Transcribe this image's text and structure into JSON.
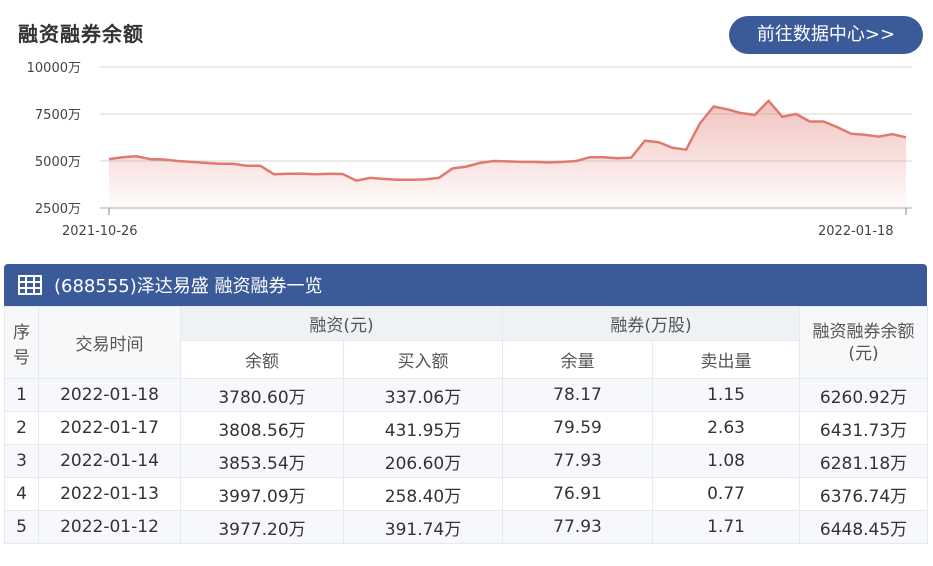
{
  "page": {
    "title": "融资融券余额",
    "goto_label": "前往数据中心>>"
  },
  "chart_data": {
    "type": "area",
    "title": "",
    "ylim": [
      2500,
      10000
    ],
    "yticks": [
      "10000万",
      "7500万",
      "5000万",
      "2500万"
    ],
    "ytick_values": [
      10000,
      7500,
      5000,
      2500
    ],
    "x_start_label": "2021-10-26",
    "x_end_label": "2022-01-18",
    "color": "#e07a70",
    "series": [
      {
        "values": [
          5100,
          5200,
          5250,
          5100,
          5080,
          5000,
          4950,
          4900,
          4850,
          4850,
          4750,
          4750,
          4300,
          4320,
          4330,
          4300,
          4320,
          4310,
          3960,
          4100,
          4050,
          4000,
          4000,
          4020,
          4100,
          4600,
          4700,
          4900,
          5000,
          4980,
          4950,
          4950,
          4920,
          4950,
          5000,
          5200,
          5200,
          5150,
          5180,
          6080,
          6000,
          5700,
          5600,
          7000,
          7900,
          7750,
          7550,
          7450,
          8200,
          7350,
          7500,
          7100,
          7100,
          6800,
          6450,
          6400,
          6300,
          6430,
          6260
        ]
      }
    ]
  },
  "table": {
    "title": "(688555)泽达易盛 融资融券一览",
    "headers": {
      "index": "序号",
      "date": "交易时间",
      "financing": "融资(元)",
      "fin_balance": "余额",
      "fin_buy": "买入额",
      "lending": "融券(万股)",
      "lend_balance": "余量",
      "lend_sell": "卖出量",
      "total": "融资融券余额(元)"
    },
    "rows": [
      {
        "idx": "1",
        "date": "2022-01-18",
        "fin_balance": "3780.60万",
        "fin_buy": "337.06万",
        "lend_balance": "78.17",
        "lend_sell": "1.15",
        "total": "6260.92万"
      },
      {
        "idx": "2",
        "date": "2022-01-17",
        "fin_balance": "3808.56万",
        "fin_buy": "431.95万",
        "lend_balance": "79.59",
        "lend_sell": "2.63",
        "total": "6431.73万"
      },
      {
        "idx": "3",
        "date": "2022-01-14",
        "fin_balance": "3853.54万",
        "fin_buy": "206.60万",
        "lend_balance": "77.93",
        "lend_sell": "1.08",
        "total": "6281.18万"
      },
      {
        "idx": "4",
        "date": "2022-01-13",
        "fin_balance": "3997.09万",
        "fin_buy": "258.40万",
        "lend_balance": "76.91",
        "lend_sell": "0.77",
        "total": "6376.74万"
      },
      {
        "idx": "5",
        "date": "2022-01-12",
        "fin_balance": "3977.20万",
        "fin_buy": "391.74万",
        "lend_balance": "77.93",
        "lend_sell": "1.71",
        "total": "6448.45万"
      }
    ]
  }
}
